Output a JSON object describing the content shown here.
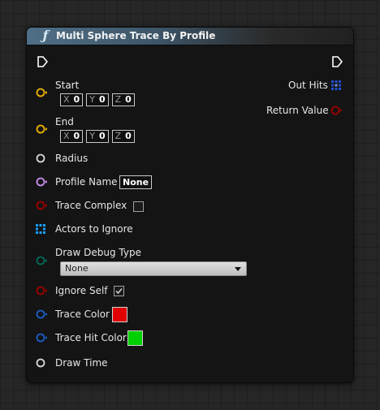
{
  "node": {
    "title": "Multi Sphere Trace By Profile",
    "function_icon": "ƒ"
  },
  "inputs": {
    "start": {
      "label": "Start",
      "x_label": "X",
      "x": "0",
      "y_label": "Y",
      "y": "0",
      "z_label": "Z",
      "z": "0"
    },
    "end": {
      "label": "End",
      "x_label": "X",
      "x": "0",
      "y_label": "Y",
      "y": "0",
      "z_label": "Z",
      "z": "0"
    },
    "radius": {
      "label": "Radius"
    },
    "profile_name": {
      "label": "Profile Name",
      "value": "None"
    },
    "trace_complex": {
      "label": "Trace Complex",
      "checked": false
    },
    "actors_to_ignore": {
      "label": "Actors to Ignore"
    },
    "draw_debug_type": {
      "label": "Draw Debug Type",
      "value": "None"
    },
    "ignore_self": {
      "label": "Ignore Self",
      "checked": true
    },
    "trace_color": {
      "label": "Trace Color",
      "color": "#e00000"
    },
    "trace_hit_color": {
      "label": "Trace Hit Color",
      "color": "#00d000"
    },
    "draw_time": {
      "label": "Draw Time"
    }
  },
  "outputs": {
    "out_hits": {
      "label": "Out Hits"
    },
    "return_value": {
      "label": "Return Value"
    }
  },
  "pin_colors": {
    "vector": "#f0b400",
    "float": "#d8d8d8",
    "name": "#c890f0",
    "bool": "#a00000",
    "actor_array": "#1aa0ff",
    "hit_array": "#2050d0",
    "enum": "#006a5a",
    "color": "#1a60c8"
  }
}
